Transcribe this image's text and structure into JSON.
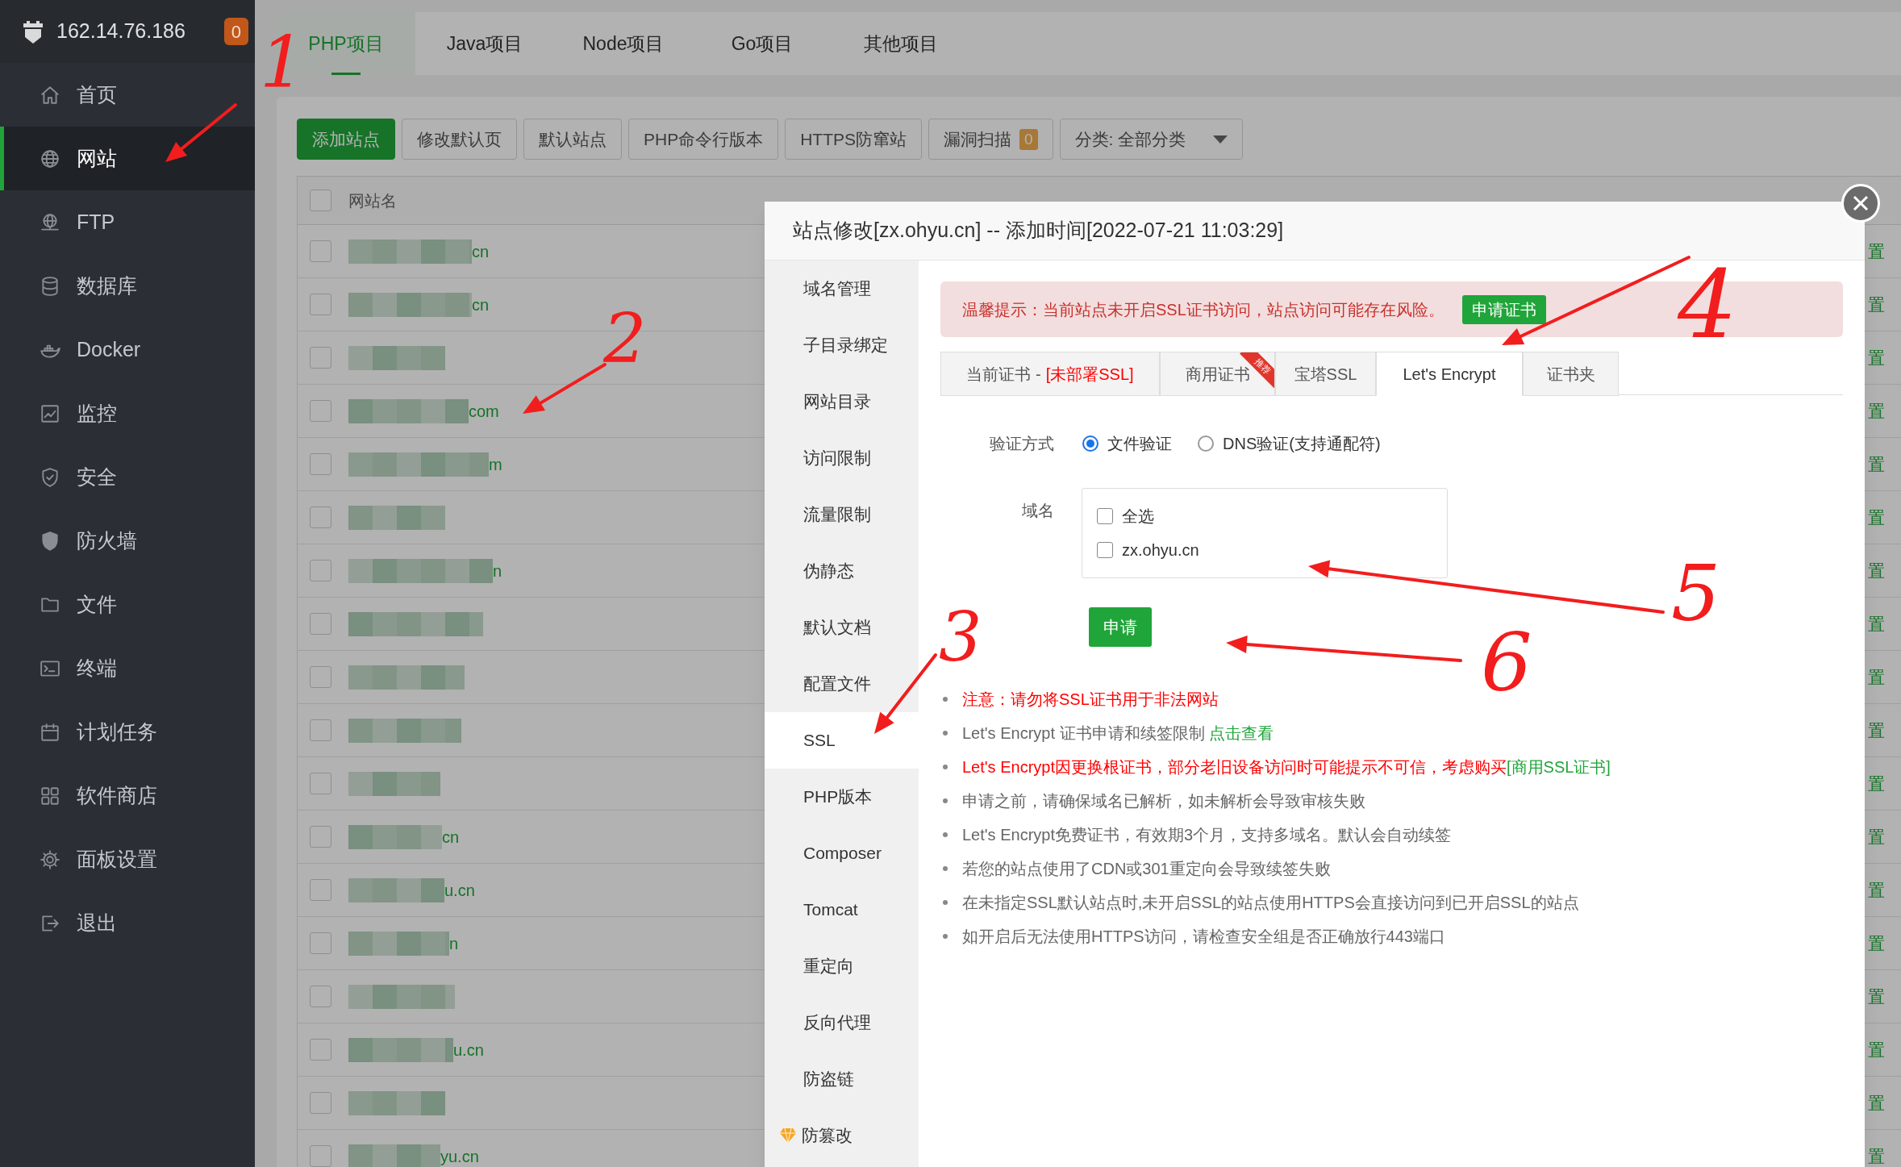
{
  "sidebar": {
    "server": "162.14.76.186",
    "badge": "0",
    "items": [
      {
        "label": "首页",
        "selected": false
      },
      {
        "label": "网站",
        "selected": true
      },
      {
        "label": "FTP",
        "selected": false
      },
      {
        "label": "数据库",
        "selected": false
      },
      {
        "label": "Docker",
        "selected": false
      },
      {
        "label": "监控",
        "selected": false
      },
      {
        "label": "安全",
        "selected": false
      },
      {
        "label": "防火墙",
        "selected": false
      },
      {
        "label": "文件",
        "selected": false
      },
      {
        "label": "终端",
        "selected": false
      },
      {
        "label": "计划任务",
        "selected": false
      },
      {
        "label": "软件商店",
        "selected": false
      },
      {
        "label": "面板设置",
        "selected": false
      },
      {
        "label": "退出",
        "selected": false
      }
    ]
  },
  "project_tabs": [
    {
      "label": "PHP项目",
      "selected": true
    },
    {
      "label": "Java项目",
      "selected": false
    },
    {
      "label": "Node项目",
      "selected": false
    },
    {
      "label": "Go项目",
      "selected": false
    },
    {
      "label": "其他项目",
      "selected": false
    }
  ],
  "toolbar": [
    {
      "label": "添加站点",
      "kind": "primary"
    },
    {
      "label": "修改默认页",
      "kind": "plain"
    },
    {
      "label": "默认站点",
      "kind": "plain"
    },
    {
      "label": "PHP命令行版本",
      "kind": "plain"
    },
    {
      "label": "HTTPS防窜站",
      "kind": "plain"
    },
    {
      "label": "漏洞扫描",
      "kind": "count",
      "count": "0"
    },
    {
      "label": "分类: 全部分类",
      "kind": "select"
    }
  ],
  "table": {
    "select_all": {
      "checked": false
    },
    "columns": [
      "网站名"
    ],
    "rows": [
      {
        "checked": false,
        "site_name": "cn",
        "column_5": "置"
      },
      {
        "checked": false,
        "site_name": "cn",
        "column_5": "置"
      },
      {
        "checked": false,
        "column_5": "置"
      },
      {
        "checked": false,
        "site_name": "com",
        "column_5": "置"
      },
      {
        "checked": false,
        "site_name": "m",
        "column_5": "置"
      },
      {
        "checked": false,
        "column_5": "置"
      },
      {
        "checked": false,
        "site_name": "n",
        "column_5": "置"
      },
      {
        "checked": false,
        "column_5": "置"
      },
      {
        "checked": false,
        "column_5": "置"
      },
      {
        "checked": false,
        "column_5": "置"
      },
      {
        "checked": false,
        "column_5": "置"
      },
      {
        "checked": false,
        "site_name": "cn",
        "column_5": "置"
      },
      {
        "checked": false,
        "site_name": "u.cn",
        "column_5": "置"
      },
      {
        "checked": false,
        "site_name": "n",
        "column_5": "置"
      },
      {
        "checked": false,
        "column_5": "置"
      },
      {
        "checked": false,
        "site_name": "u.cn",
        "column_5": "置"
      },
      {
        "checked": false,
        "column_5": "置"
      },
      {
        "checked": false,
        "site_name": "yu.cn",
        "column_5": "置"
      }
    ]
  },
  "dialog": {
    "title": "站点修改[zx.ohyu.cn] -- 添加时间[2022-07-21 11:03:29]",
    "nav": [
      {
        "label": "域名管理",
        "selected": false,
        "kind": "plain"
      },
      {
        "label": "子目录绑定",
        "selected": false,
        "kind": "plain"
      },
      {
        "label": "网站目录",
        "selected": false,
        "kind": "plain"
      },
      {
        "label": "访问限制",
        "selected": false,
        "kind": "plain"
      },
      {
        "label": "流量限制",
        "selected": false,
        "kind": "plain"
      },
      {
        "label": "伪静态",
        "selected": false,
        "kind": "plain"
      },
      {
        "label": "默认文档",
        "selected": false,
        "kind": "plain"
      },
      {
        "label": "配置文件",
        "selected": false,
        "kind": "plain"
      },
      {
        "label": "SSL",
        "selected": true,
        "kind": "plain"
      },
      {
        "label": "PHP版本",
        "selected": false,
        "kind": "plain"
      },
      {
        "label": "Composer",
        "selected": false,
        "kind": "plain"
      },
      {
        "label": "Tomcat",
        "selected": false,
        "kind": "plain"
      },
      {
        "label": "重定向",
        "selected": false,
        "kind": "plain"
      },
      {
        "label": "反向代理",
        "selected": false,
        "kind": "plain"
      },
      {
        "label": "防盗链",
        "selected": false,
        "kind": "plain"
      },
      {
        "label": "防篡改",
        "selected": false,
        "kind": "premium"
      }
    ],
    "alert": {
      "text": "温馨提示：当前站点未开启SSL证书访问，站点访问可能存在风险。",
      "button": "申请证书"
    },
    "ssl_tabs": [
      {
        "label": "当前证书 -",
        "status": "[未部署SSL]",
        "selected": false
      },
      {
        "label": "商用证书",
        "ribbon": "推荐",
        "selected": false
      },
      {
        "label": "宝塔SSL",
        "selected": false
      },
      {
        "label": "Let's Encrypt",
        "selected": true
      },
      {
        "label": "证书夹",
        "selected": false
      }
    ],
    "verify": {
      "label": "验证方式",
      "options": [
        {
          "label": "文件验证",
          "selected": true
        },
        {
          "label": "DNS验证(支持通配符)",
          "selected": false
        }
      ]
    },
    "domains": {
      "label": "域名",
      "items": [
        {
          "label": "全选",
          "checked": false
        },
        {
          "label": "zx.ohyu.cn",
          "checked": false
        }
      ]
    },
    "submit": "申请",
    "notes": [
      {
        "kind": "warning",
        "text": "注意：请勿将SSL证书用于非法网站"
      },
      {
        "kind": "normal",
        "text": "Let's Encrypt 证书申请和续签限制 ",
        "link": "点击查看"
      },
      {
        "kind": "warning",
        "text": "Let's Encrypt因更换根证书，部分老旧设备访问时可能提示不可信，考虑购买",
        "link": "[商用SSL证书]"
      },
      {
        "kind": "normal",
        "text": "申请之前，请确保域名已解析，如未解析会导致审核失败"
      },
      {
        "kind": "normal",
        "text": "Let's Encrypt免费证书，有效期3个月，支持多域名。默认会自动续签"
      },
      {
        "kind": "normal",
        "text": "若您的站点使用了CDN或301重定向会导致续签失败"
      },
      {
        "kind": "normal",
        "text": "在未指定SSL默认站点时,未开启SSL的站点使用HTTPS会直接访问到已开启SSL的站点"
      },
      {
        "kind": "normal",
        "text": "如开启后无法使用HTTPS访问，请检查安全组是否正确放行443端口"
      }
    ]
  },
  "annotations": [
    {
      "label": "1"
    },
    {
      "label": "2"
    },
    {
      "label": "3"
    },
    {
      "label": "4"
    },
    {
      "label": "5"
    },
    {
      "label": "6"
    }
  ]
}
